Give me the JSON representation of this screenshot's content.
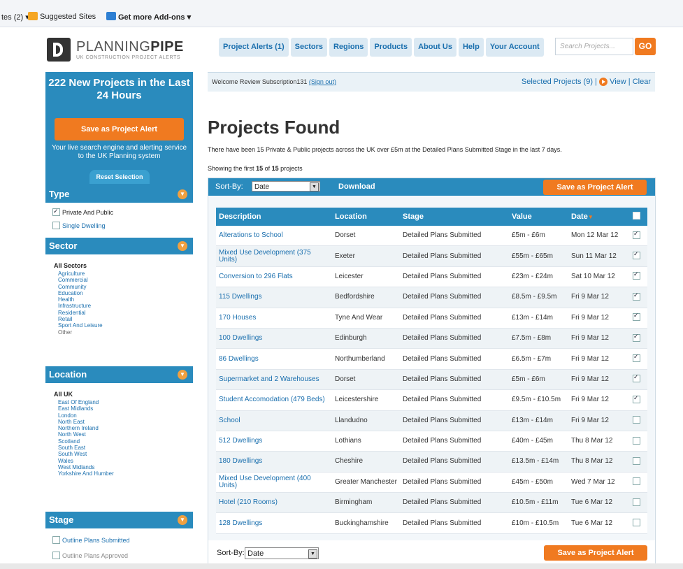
{
  "favorites": {
    "sites_label": "tes (2)",
    "suggested": "Suggested Sites",
    "addons": "Get more Add-ons"
  },
  "logo": {
    "name_light": "PLANNING",
    "name_bold": "PIPE",
    "tagline": "UK CONSTRUCTION PROJECT ALERTS"
  },
  "nav": {
    "items": [
      "Project Alerts (1)",
      "Sectors",
      "Regions",
      "Products",
      "About Us",
      "Help",
      "Your Account"
    ],
    "search_placeholder": "Search Projects...",
    "go": "GO"
  },
  "sidebar": {
    "promo_title": "222 New Projects in the Last 24 Hours",
    "save_alert": "Save as Project Alert",
    "promo_text": "Your live search engine and alerting service to the UK Planning system",
    "reset": "Reset Selection",
    "type": {
      "title": "Type",
      "options": [
        {
          "label": "Private And Public",
          "checked": true
        },
        {
          "label": "Single Dwelling",
          "checked": false
        }
      ]
    },
    "sector": {
      "title": "Sector",
      "all": "All Sectors",
      "items": [
        "Agriculture",
        "Commercial",
        "Community",
        "Education",
        "Health",
        "Infrastructure",
        "Residential",
        "Retail",
        "Sport And Leisure",
        "Other"
      ]
    },
    "location": {
      "title": "Location",
      "all": "All UK",
      "items": [
        "East Of England",
        "East Midlands",
        "London",
        "North East",
        "Northern Ireland",
        "North West",
        "Scotland",
        "South East",
        "South West",
        "Wales",
        "West Midlands",
        "Yorkshire And Humber"
      ]
    },
    "stage": {
      "title": "Stage",
      "options": [
        {
          "label": "Outline Plans Submitted",
          "checked": false
        },
        {
          "label": "Outline Plans Approved",
          "checked": false
        }
      ]
    }
  },
  "welcome": {
    "text": "Welcome Review Subscription131",
    "signout": "(Sign out)",
    "selected": "Selected Projects (9)",
    "view": "View",
    "clear": "Clear",
    "sep": "|"
  },
  "main": {
    "title": "Projects Found",
    "summary": "There have been 15 Private & Public projects across the UK over £5m at the Detailed Plans Submitted Stage in the last 7 days.",
    "showing_prefix": "Showing the first",
    "showing_count": "15",
    "showing_mid": "of",
    "showing_total": "15",
    "showing_suffix": "projects",
    "sort_label": "Sort-By:",
    "sort_value": "Date",
    "download": "Download",
    "save_alert": "Save as Project Alert"
  },
  "table": {
    "headers": [
      "Description",
      "Location",
      "Stage",
      "Value",
      "Date"
    ],
    "rows": [
      {
        "desc": "Alterations to School",
        "loc": "Dorset",
        "stage": "Detailed Plans Submitted",
        "value": "£5m - £6m",
        "date": "Mon 12 Mar 12",
        "checked": true
      },
      {
        "desc": "Mixed Use Development (375 Units)",
        "loc": "Exeter",
        "stage": "Detailed Plans Submitted",
        "value": "£55m - £65m",
        "date": "Sun 11 Mar 12",
        "checked": true
      },
      {
        "desc": "Conversion to 296 Flats",
        "loc": "Leicester",
        "stage": "Detailed Plans Submitted",
        "value": "£23m - £24m",
        "date": "Sat 10 Mar 12",
        "checked": true
      },
      {
        "desc": "115 Dwellings",
        "loc": "Bedfordshire",
        "stage": "Detailed Plans Submitted",
        "value": "£8.5m - £9.5m",
        "date": "Fri 9 Mar 12",
        "checked": true
      },
      {
        "desc": "170 Houses",
        "loc": "Tyne And Wear",
        "stage": "Detailed Plans Submitted",
        "value": "£13m - £14m",
        "date": "Fri 9 Mar 12",
        "checked": true
      },
      {
        "desc": "100 Dwellings",
        "loc": "Edinburgh",
        "stage": "Detailed Plans Submitted",
        "value": "£7.5m - £8m",
        "date": "Fri 9 Mar 12",
        "checked": true
      },
      {
        "desc": "86 Dwellings",
        "loc": "Northumberland",
        "stage": "Detailed Plans Submitted",
        "value": "£6.5m - £7m",
        "date": "Fri 9 Mar 12",
        "checked": true
      },
      {
        "desc": "Supermarket and 2 Warehouses",
        "loc": "Dorset",
        "stage": "Detailed Plans Submitted",
        "value": "£5m - £6m",
        "date": "Fri 9 Mar 12",
        "checked": true
      },
      {
        "desc": "Student Accomodation (479 Beds)",
        "loc": "Leicestershire",
        "stage": "Detailed Plans Submitted",
        "value": "£9.5m - £10.5m",
        "date": "Fri 9 Mar 12",
        "checked": true
      },
      {
        "desc": "School",
        "loc": "Llandudno",
        "stage": "Detailed Plans Submitted",
        "value": "£13m - £14m",
        "date": "Fri 9 Mar 12",
        "checked": false
      },
      {
        "desc": "512 Dwellings",
        "loc": "Lothians",
        "stage": "Detailed Plans Submitted",
        "value": "£40m - £45m",
        "date": "Thu 8 Mar 12",
        "checked": false
      },
      {
        "desc": "180 Dwellings",
        "loc": "Cheshire",
        "stage": "Detailed Plans Submitted",
        "value": "£13.5m - £14m",
        "date": "Thu 8 Mar 12",
        "checked": false
      },
      {
        "desc": "Mixed Use Development (400 Units)",
        "loc": "Greater Manchester",
        "stage": "Detailed Plans Submitted",
        "value": "£45m - £50m",
        "date": "Wed 7 Mar 12",
        "checked": false
      },
      {
        "desc": "Hotel (210 Rooms)",
        "loc": "Birmingham",
        "stage": "Detailed Plans Submitted",
        "value": "£10.5m - £11m",
        "date": "Tue 6 Mar 12",
        "checked": false
      },
      {
        "desc": "128 Dwellings",
        "loc": "Buckinghamshire",
        "stage": "Detailed Plans Submitted",
        "value": "£10m - £10.5m",
        "date": "Tue 6 Mar 12",
        "checked": false
      }
    ]
  },
  "colors": {
    "brand_blue": "#2a8bbd",
    "accent_orange": "#f07a20",
    "link": "#1a6fae"
  }
}
